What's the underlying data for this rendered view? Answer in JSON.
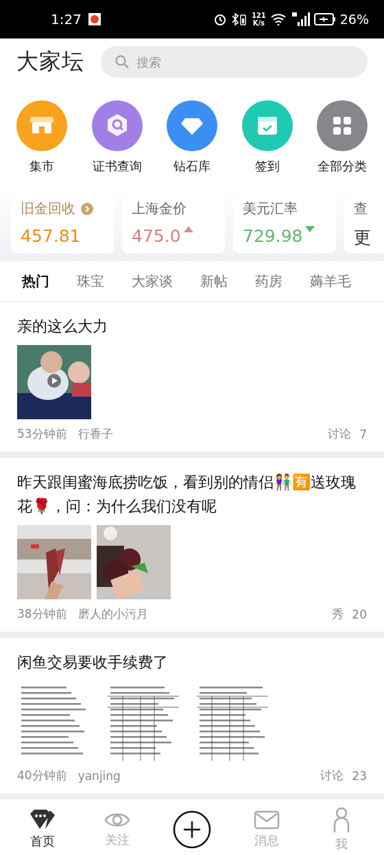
{
  "status_bar": {
    "time": "1:27",
    "speed": "121",
    "speed_unit": "K/s",
    "battery": "26%"
  },
  "header": {
    "logo": "大家坛",
    "search": {
      "placeholder": "搜索"
    }
  },
  "shortcuts": [
    {
      "label": "集市",
      "kind": "shop",
      "color": "#f9a21b"
    },
    {
      "label": "证书查询",
      "kind": "cert",
      "color": "#a17fe6"
    },
    {
      "label": "钻石库",
      "kind": "diamond",
      "color": "#3c8ff2"
    },
    {
      "label": "签到",
      "kind": "calendar",
      "color": "#1fc9b2"
    },
    {
      "label": "全部分类",
      "kind": "grid",
      "color": "#86868c"
    }
  ],
  "price_cards": [
    {
      "title": "旧金回收",
      "value": "457.81",
      "link": true,
      "color": "#e8901c"
    },
    {
      "title": "上海金价",
      "value": "475.0",
      "up": true,
      "link": false,
      "color": "#d98080"
    },
    {
      "title": "美元汇率",
      "value": "729.98",
      "up": false,
      "link": false,
      "color": "#5cb86a"
    },
    {
      "title": "查",
      "value": "更",
      "link": false,
      "color": "#333333"
    }
  ],
  "tabs": [
    {
      "label": "热门",
      "selected": true
    },
    {
      "label": "珠宝",
      "selected": false
    },
    {
      "label": "大家谈",
      "selected": false
    },
    {
      "label": "新帖",
      "selected": false
    },
    {
      "label": "药房",
      "selected": false
    },
    {
      "label": "薅羊毛",
      "selected": false
    }
  ],
  "posts": [
    {
      "title": "亲的这么大力",
      "images": [
        {
          "kind": "video"
        }
      ],
      "time": "53分钟前",
      "author": "行香子",
      "tag": "讨论",
      "count": "7"
    },
    {
      "title": "昨天跟闺蜜海底捞吃饭，看到别的情侣👫🈶送玫瑰花🌹，问：为什么我们没有呢",
      "time": "38分钟前",
      "author": "磨人的小污月",
      "tag": "秀",
      "count": "20"
    },
    {
      "title": "闲鱼交易要收手续费了",
      "images": [
        {
          "kind": "document"
        },
        {
          "kind": "document"
        },
        {
          "kind": "document"
        }
      ],
      "time": "40分钟前",
      "author": "yanjing",
      "tag": "讨论",
      "count": "23"
    }
  ],
  "bottom_nav": [
    {
      "label": "首页",
      "kind": "home",
      "selected": true
    },
    {
      "label": "关注",
      "kind": "eye",
      "selected": false
    },
    {
      "kind": "plus"
    },
    {
      "label": "消息",
      "kind": "mail",
      "selected": false
    },
    {
      "label": "我",
      "kind": "person",
      "selected": false
    }
  ]
}
